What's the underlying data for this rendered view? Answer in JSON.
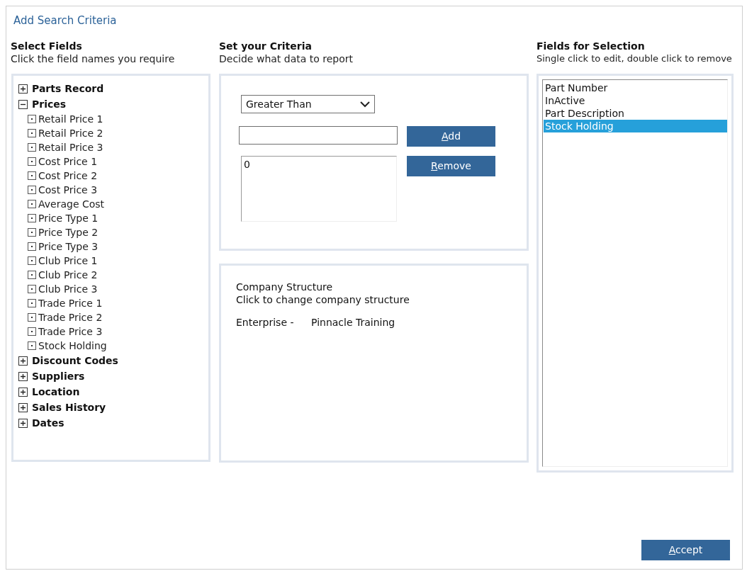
{
  "window": {
    "title": "Add Search Criteria"
  },
  "select_fields": {
    "heading": "Select Fields",
    "subtitle": "Click the field names you require",
    "tree": [
      {
        "label": "Parts Record",
        "expanded": false
      },
      {
        "label": "Prices",
        "expanded": true,
        "children": [
          {
            "label": "Retail Price 1"
          },
          {
            "label": "Retail Price 2"
          },
          {
            "label": "Retail Price 3"
          },
          {
            "label": "Cost Price 1"
          },
          {
            "label": "Cost Price 2"
          },
          {
            "label": "Cost Price 3"
          },
          {
            "label": "Average Cost"
          },
          {
            "label": "Price Type 1"
          },
          {
            "label": "Price Type 2"
          },
          {
            "label": "Price Type 3"
          },
          {
            "label": "Club Price 1"
          },
          {
            "label": "Club Price 2"
          },
          {
            "label": "Club Price 3"
          },
          {
            "label": "Trade Price 1"
          },
          {
            "label": "Trade Price 2"
          },
          {
            "label": "Trade Price 3"
          },
          {
            "label": "Stock Holding"
          }
        ]
      },
      {
        "label": "Discount Codes",
        "expanded": false
      },
      {
        "label": "Suppliers",
        "expanded": false
      },
      {
        "label": "Location",
        "expanded": false
      },
      {
        "label": "Sales History",
        "expanded": false
      },
      {
        "label": "Dates",
        "expanded": false
      }
    ]
  },
  "criteria": {
    "heading": "Set your Criteria",
    "subtitle": "Decide what data to report",
    "operator": "Greater Than",
    "values": [
      "0"
    ],
    "buttons": [
      {
        "label": "Add",
        "first_letter_underlined": true
      },
      {
        "label": "Remove",
        "first_letter_underlined": true
      }
    ]
  },
  "company": {
    "heading": "Company Structure",
    "subtitle": "Click to change company structure",
    "label": "Enterprise -",
    "value": "Pinnacle Training"
  },
  "fields_for_selection": {
    "heading": "Fields for Selection",
    "subtitle": "Single click to edit, double click to remove",
    "items": [
      {
        "label": "Part Number",
        "selected": false
      },
      {
        "label": "InActive",
        "selected": false
      },
      {
        "label": "Part Description",
        "selected": false
      },
      {
        "label": "Stock Holding",
        "selected": true
      }
    ]
  },
  "accept_button": {
    "label": "Accept",
    "first_letter_underlined": true
  }
}
